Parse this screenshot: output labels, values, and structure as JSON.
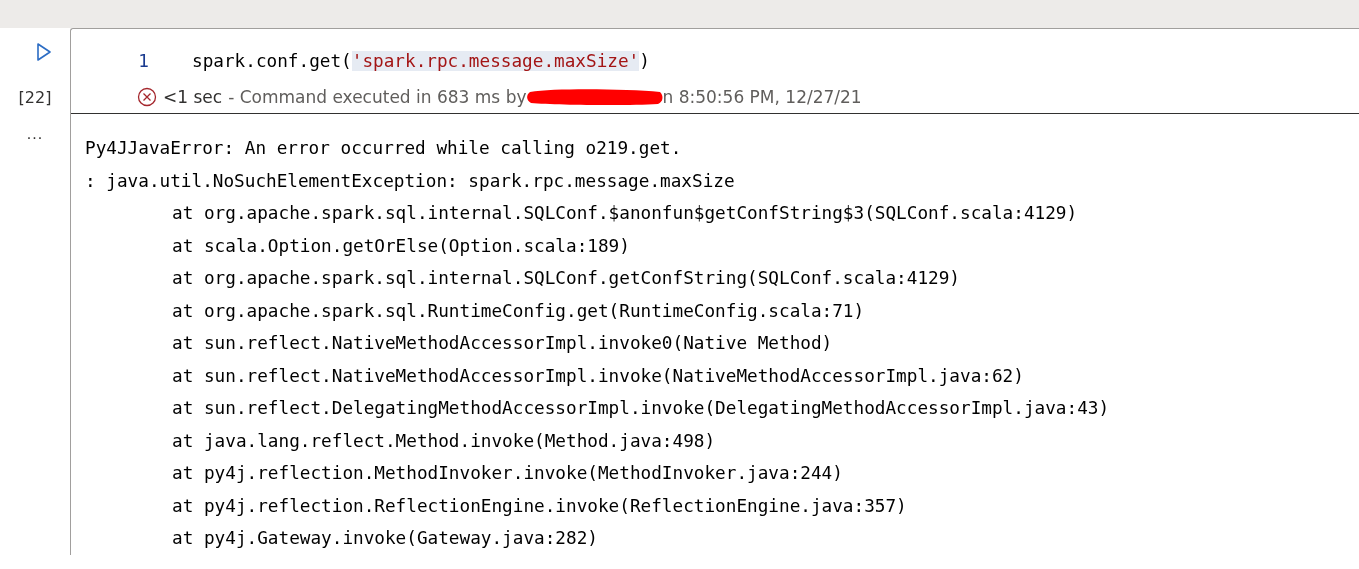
{
  "cell": {
    "run_label": "[22]",
    "more": "...",
    "code_lines": [
      {
        "number": "1",
        "parts": [
          {
            "kind": "plain",
            "text": "spark.conf.get("
          },
          {
            "kind": "string",
            "text": "'spark.rpc.message.maxSize'"
          },
          {
            "kind": "plain",
            "text": ")"
          }
        ]
      }
    ],
    "status": {
      "error": true,
      "duration": "<1 sec",
      "text_before": "- Command executed in 683 ms by",
      "text_after": "n 8:50:56 PM, 12/27/21"
    },
    "output": [
      {
        "kind": "message",
        "text": "Py4JJavaError: An error occurred while calling o219.get."
      },
      {
        "kind": "message",
        "text": ": java.util.NoSuchElementException: spark.rpc.message.maxSize"
      },
      {
        "kind": "frame",
        "text": "at org.apache.spark.sql.internal.SQLConf.$anonfun$getConfString$3(SQLConf.scala:4129)"
      },
      {
        "kind": "frame",
        "text": "at scala.Option.getOrElse(Option.scala:189)"
      },
      {
        "kind": "frame",
        "text": "at org.apache.spark.sql.internal.SQLConf.getConfString(SQLConf.scala:4129)"
      },
      {
        "kind": "frame",
        "text": "at org.apache.spark.sql.RuntimeConfig.get(RuntimeConfig.scala:71)"
      },
      {
        "kind": "frame",
        "text": "at sun.reflect.NativeMethodAccessorImpl.invoke0(Native Method)"
      },
      {
        "kind": "frame",
        "text": "at sun.reflect.NativeMethodAccessorImpl.invoke(NativeMethodAccessorImpl.java:62)"
      },
      {
        "kind": "frame",
        "text": "at sun.reflect.DelegatingMethodAccessorImpl.invoke(DelegatingMethodAccessorImpl.java:43)"
      },
      {
        "kind": "frame",
        "text": "at java.lang.reflect.Method.invoke(Method.java:498)"
      },
      {
        "kind": "frame",
        "text": "at py4j.reflection.MethodInvoker.invoke(MethodInvoker.java:244)"
      },
      {
        "kind": "frame",
        "text": "at py4j.reflection.ReflectionEngine.invoke(ReflectionEngine.java:357)"
      },
      {
        "kind": "frame",
        "text": "at py4j.Gateway.invoke(Gateway.java:282)"
      }
    ]
  }
}
